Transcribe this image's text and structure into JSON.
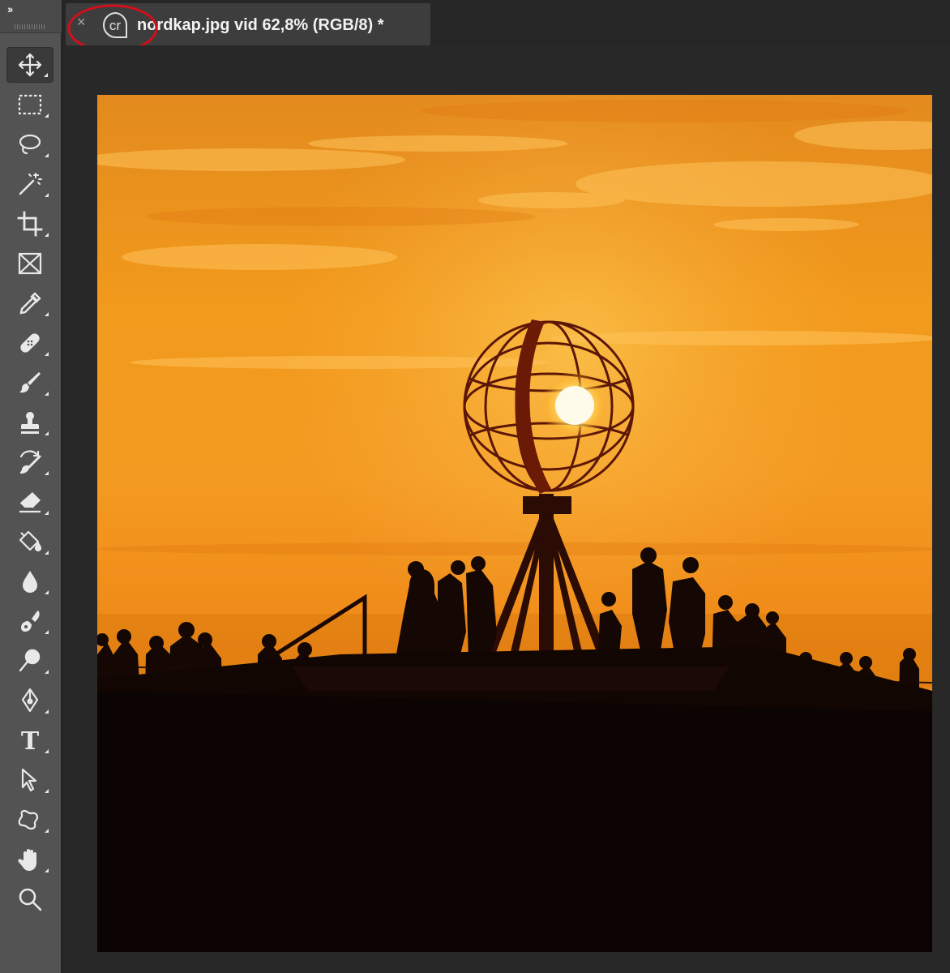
{
  "toolbar": {
    "collapse_glyph": "››",
    "tools": [
      {
        "name": "move-tool",
        "icon": "move-icon",
        "active": true
      },
      {
        "name": "rectangular-marquee-tool",
        "icon": "marquee-icon"
      },
      {
        "name": "lasso-tool",
        "icon": "lasso-icon"
      },
      {
        "name": "magic-wand-tool",
        "icon": "magic-wand-icon"
      },
      {
        "name": "crop-tool",
        "icon": "crop-icon"
      },
      {
        "name": "frame-tool",
        "icon": "frame-icon"
      },
      {
        "name": "eyedropper-tool",
        "icon": "eyedropper-icon"
      },
      {
        "name": "healing-brush-tool",
        "icon": "bandage-icon"
      },
      {
        "name": "brush-tool",
        "icon": "brush-icon"
      },
      {
        "name": "clone-stamp-tool",
        "icon": "stamp-icon"
      },
      {
        "name": "history-brush-tool",
        "icon": "history-brush-icon"
      },
      {
        "name": "eraser-tool",
        "icon": "eraser-icon"
      },
      {
        "name": "paint-bucket-tool",
        "icon": "paint-bucket-icon"
      },
      {
        "name": "blur-tool",
        "icon": "drop-icon"
      },
      {
        "name": "dodge-tool",
        "icon": "dodge-icon"
      },
      {
        "name": "pen-tool",
        "icon": "pen-icon"
      },
      {
        "name": "type-tool",
        "icon": "type-icon",
        "glyph": "T"
      },
      {
        "name": "path-selection-tool",
        "icon": "arrow-icon"
      },
      {
        "name": "custom-shape-tool",
        "icon": "shape-icon"
      },
      {
        "name": "hand-tool",
        "icon": "hand-icon"
      },
      {
        "name": "zoom-tool",
        "icon": "zoom-icon"
      }
    ]
  },
  "document_tab": {
    "close_glyph": "×",
    "badge_text": "cr",
    "title": "nordkap.jpg vid 62,8% (RGB/8) *"
  },
  "colors": {
    "annotation": "#d0101a",
    "panel": "#535353",
    "canvas_bg": "#282828",
    "tab_bg": "#3d3d3d"
  }
}
